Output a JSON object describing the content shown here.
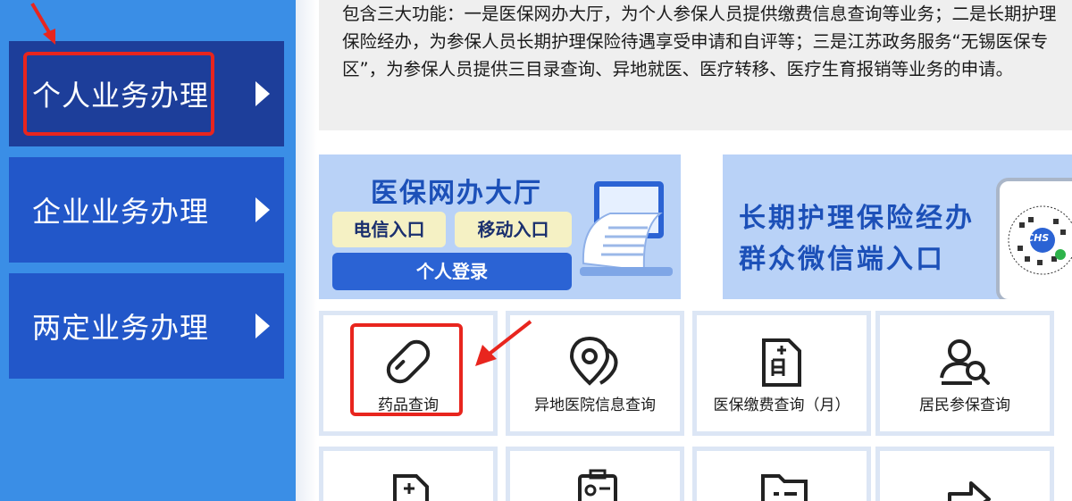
{
  "sidebar": {
    "items": [
      {
        "label": "个人业务办理",
        "active": true
      },
      {
        "label": "企业业务办理",
        "active": false
      },
      {
        "label": "两定业务办理",
        "active": false
      }
    ]
  },
  "intro": {
    "text": "包含三大功能：一是医保网办大厅，为个人参保人员提供缴费信息查询等业务；二是长期护理保险经办，为参保人员长期护理保险待遇享受申请和自评等；三是江苏政务服务“无锡医保专区”，为参保人员提供三目录查询、异地就医、医疗转移、医疗生育报销等业务的申请。"
  },
  "banners": {
    "left": {
      "title": "医保网办大厅",
      "telecom_label": "电信入口",
      "mobile_label": "移动入口",
      "login_label": "个人登录"
    },
    "right": {
      "line1": "长期护理保险经办",
      "line2": "群众微信端入口",
      "qr_label": "CHS"
    }
  },
  "tiles": [
    {
      "label": "药品查询",
      "icon": "pill-icon"
    },
    {
      "label": "异地医院信息查询",
      "icon": "location-pin-icon"
    },
    {
      "label": "医保缴费查询（月）",
      "icon": "calendar-month-icon"
    },
    {
      "label": "居民参保查询",
      "icon": "user-search-icon"
    }
  ],
  "tiles_row2_icons": [
    "document-plus-icon",
    "id-card-icon",
    "folder-list-icon",
    "transfer-arrow-icon"
  ],
  "colors": {
    "sidebar_bg": "#3a8ee6",
    "nav_item": "#2257c9",
    "nav_active": "#1d3e9a",
    "highlight_red": "#e8251e",
    "banner_bg": "#b9d2f7",
    "brand_blue": "#1c50b8"
  }
}
